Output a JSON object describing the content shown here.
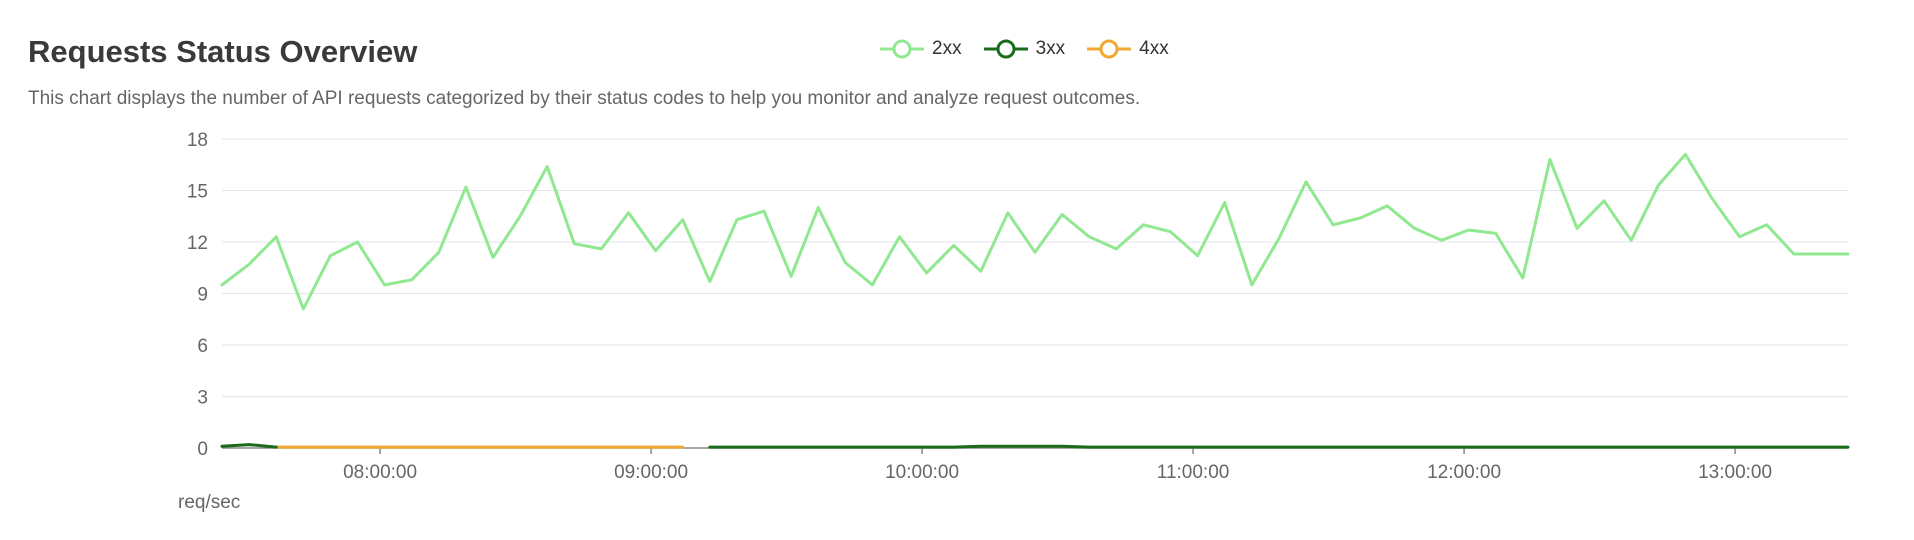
{
  "header": {
    "title": "Requests Status Overview",
    "description": "This chart displays the number of API requests categorized by their status codes to help you monitor and analyze request outcomes."
  },
  "chart_data": {
    "type": "line",
    "title": "Requests Status Overview",
    "ylabel": "req/sec",
    "xlabel": "",
    "ylim": [
      0,
      18
    ],
    "yticks": [
      0,
      3,
      6,
      9,
      12,
      15,
      18
    ],
    "xlim": [
      "07:25",
      "13:25"
    ],
    "xticks": [
      "08:00:00",
      "09:00:00",
      "10:00:00",
      "11:00:00",
      "12:00:00",
      "13:00:00"
    ],
    "grid": true,
    "legend": "top-center",
    "x": [
      "07:25",
      "07:31",
      "07:37",
      "07:43",
      "07:49",
      "07:55",
      "08:01",
      "08:07",
      "08:13",
      "08:19",
      "08:25",
      "08:31",
      "08:37",
      "08:43",
      "08:49",
      "08:55",
      "09:01",
      "09:07",
      "09:13",
      "09:19",
      "09:25",
      "09:31",
      "09:37",
      "09:43",
      "09:49",
      "09:55",
      "10:01",
      "10:07",
      "10:13",
      "10:19",
      "10:25",
      "10:31",
      "10:37",
      "10:43",
      "10:49",
      "10:55",
      "11:01",
      "11:07",
      "11:13",
      "11:19",
      "11:25",
      "11:31",
      "11:37",
      "11:43",
      "11:49",
      "11:55",
      "12:01",
      "12:07",
      "12:13",
      "12:19",
      "12:25",
      "12:31",
      "12:37",
      "12:43",
      "12:49",
      "12:55",
      "13:01",
      "13:07",
      "13:13",
      "13:19",
      "13:25"
    ],
    "series": [
      {
        "name": "2xx",
        "color": "#90e890",
        "values": [
          9.5,
          10.7,
          12.3,
          8.1,
          11.2,
          12.0,
          9.5,
          9.8,
          11.4,
          15.2,
          11.1,
          13.5,
          16.4,
          11.9,
          11.6,
          13.7,
          11.5,
          13.3,
          9.7,
          13.3,
          13.8,
          10.0,
          14.0,
          10.8,
          9.5,
          12.3,
          10.2,
          11.8,
          10.3,
          13.7,
          11.4,
          13.6,
          12.3,
          11.6,
          13.0,
          12.6,
          11.2,
          14.3,
          9.5,
          12.2,
          15.5,
          13.0,
          13.4,
          14.1,
          12.8,
          12.1,
          12.7,
          12.5,
          9.9,
          16.8,
          12.8,
          14.4,
          12.1,
          15.3,
          17.1,
          14.5,
          12.3,
          13.0,
          11.3,
          11.3,
          11.3
        ]
      },
      {
        "name": "3xx",
        "color": "#1a6b1a",
        "values": [
          0.1,
          0.2,
          0.05,
          null,
          null,
          null,
          null,
          null,
          null,
          null,
          null,
          null,
          null,
          null,
          null,
          null,
          null,
          null,
          0.05,
          0.05,
          0.05,
          0.05,
          0.05,
          0.05,
          0.05,
          0.05,
          0.05,
          0.05,
          0.1,
          0.1,
          0.1,
          0.1,
          0.05,
          0.05,
          0.05,
          0.05,
          0.05,
          0.05,
          0.05,
          0.05,
          0.05,
          0.05,
          0.05,
          0.05,
          0.05,
          0.05,
          0.05,
          0.05,
          0.05,
          0.05,
          0.05,
          0.05,
          0.05,
          0.05,
          0.05,
          0.05,
          0.05,
          0.05,
          0.05,
          0.05,
          0.05
        ]
      },
      {
        "name": "4xx",
        "color": "#f0a830",
        "values": [
          null,
          null,
          0.05,
          0.05,
          0.05,
          0.05,
          0.05,
          0.05,
          0.05,
          0.05,
          0.05,
          0.05,
          0.05,
          0.05,
          0.05,
          0.05,
          0.05,
          0.05,
          null,
          null,
          null,
          null,
          null,
          null,
          null,
          null,
          null,
          null,
          null,
          null,
          null,
          null,
          null,
          null,
          null,
          null,
          null,
          null,
          null,
          null,
          null,
          null,
          null,
          null,
          null,
          null,
          null,
          null,
          null,
          null,
          null,
          null,
          null,
          null,
          null,
          null,
          null,
          null,
          null,
          null,
          null
        ]
      }
    ]
  }
}
